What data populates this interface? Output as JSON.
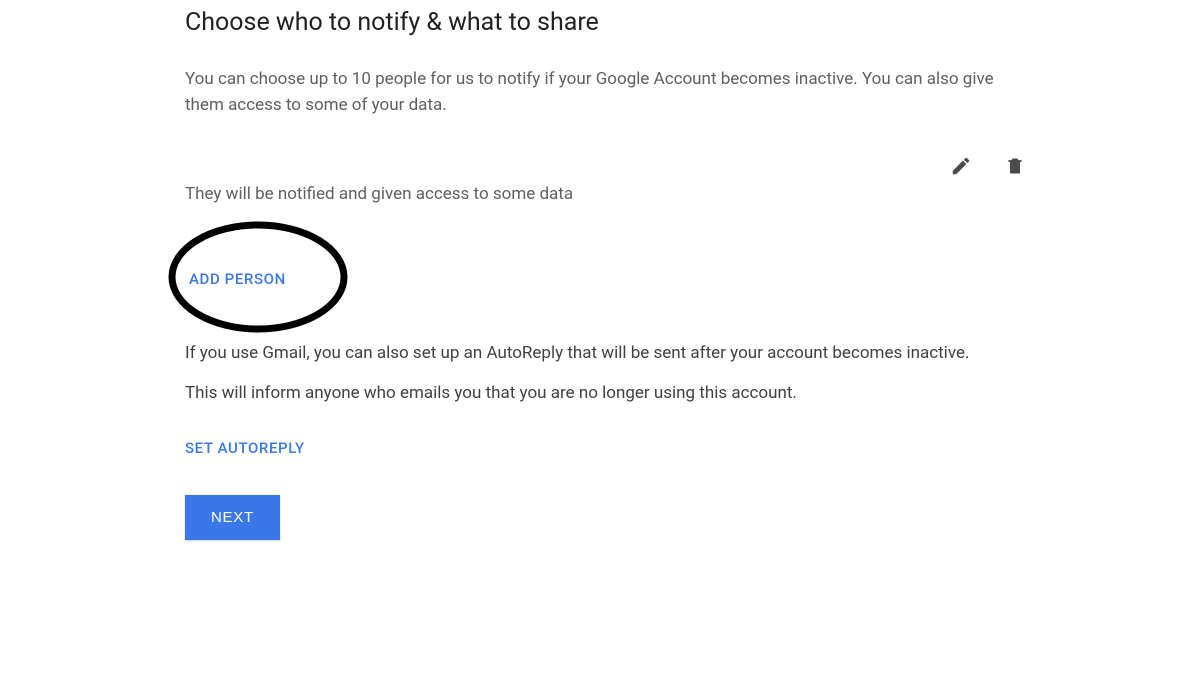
{
  "header": {
    "title": "Choose who to notify & what to share"
  },
  "description": "You can choose up to 10 people for us to notify if your Google Account becomes inactive. You can also give them access to some of your data.",
  "notify_subtext": "They will be notified and given access to some data",
  "actions": {
    "add_person_label": "ADD PERSON",
    "set_autoreply_label": "SET AUTOREPLY",
    "next_label": "NEXT"
  },
  "autoreply": {
    "paragraph1": "If you use Gmail, you can also set up an AutoReply that will be sent after your account becomes inactive.",
    "paragraph2": "This will inform anyone who emails you that you are no longer using this account."
  },
  "icons": {
    "edit": "pencil-icon",
    "delete": "trash-icon"
  }
}
